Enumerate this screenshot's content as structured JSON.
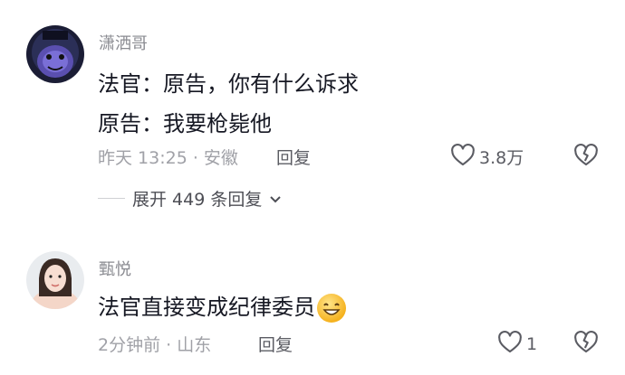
{
  "comments": [
    {
      "username": "潇洒哥",
      "lines": [
        "法官：原告，你有什么诉求",
        "原告：我要枪毙他"
      ],
      "time": "昨天 13:25",
      "location": "安徽",
      "reply_label": "回复",
      "likes": "3.8万",
      "expand_label": "展开 449 条回复",
      "avatar_icon": "purple-monster-avatar"
    },
    {
      "username": "甄悦",
      "lines": [
        "法官直接变成纪律委员"
      ],
      "emoji": "grinning-sweat-emoji",
      "time": "2分钟前",
      "location": "山东",
      "reply_label": "回复",
      "likes": "1",
      "avatar_icon": "girl-photo-avatar"
    }
  ],
  "separator": " · ",
  "colors": {
    "primary_text": "#161823",
    "secondary_text": "#a0a1a7",
    "username": "#8a8b91"
  }
}
